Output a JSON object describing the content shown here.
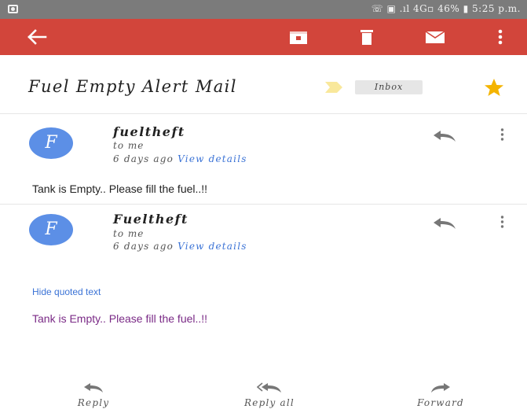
{
  "status_bar": {
    "text": "☏ ▣ .ıl 4G▫ 46% ▮ 5:25 p.m."
  },
  "toolbar": {
    "back_icon": "back-arrow-icon",
    "actions": [
      "archive-icon",
      "delete-icon",
      "mail-icon",
      "overflow-menu-icon"
    ]
  },
  "email": {
    "subject": "Fuel Empty Alert Mail",
    "label": "Inbox",
    "starred": true
  },
  "messages": [
    {
      "avatar_letter": "F",
      "sender": "fueltheft",
      "recipient": "to me",
      "time": "6 days ago",
      "view_details": "View details",
      "body": "Tank is Empty.. Please fill the fuel..!!"
    },
    {
      "avatar_letter": "F",
      "sender": "Fueltheft",
      "recipient": "to me",
      "time": "6 days ago",
      "view_details": "View details",
      "hide_quoted": "Hide quoted text",
      "quoted_body": "Tank is Empty.. Please fill the fuel..!!"
    }
  ],
  "bottom_actions": {
    "reply": "Reply",
    "reply_all": "Reply all",
    "forward": "Forward"
  },
  "colors": {
    "app_bar": "#d2453b",
    "avatar": "#5c8fe6",
    "link": "#3b73d6",
    "quoted_text": "#7a2a86",
    "star": "#f4b400"
  }
}
